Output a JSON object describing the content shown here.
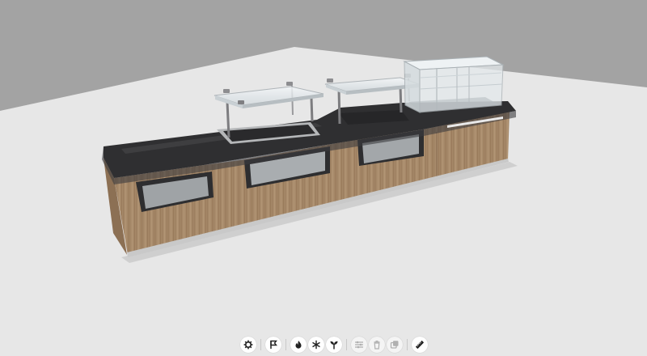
{
  "scene": {
    "model": "food-service-counter",
    "colors": {
      "sky": "#a3a3a3",
      "floor": "#e7e7e7",
      "countertop": "#2f2f31",
      "countertop_edge": "#3b3b3d",
      "wood": "#a78a6a",
      "glass": "#dfe6ea",
      "steel": "#bdbdbd"
    }
  },
  "toolbar": {
    "buttons": [
      {
        "icon": "gear-icon",
        "enabled": true
      },
      {
        "icon": "flag-icon",
        "enabled": true
      },
      {
        "icon": "flame-icon",
        "enabled": true
      },
      {
        "icon": "snowflake-icon",
        "enabled": true
      },
      {
        "icon": "plant-icon",
        "enabled": true
      },
      {
        "icon": "sliders-icon",
        "enabled": false
      },
      {
        "icon": "trash-icon",
        "enabled": false
      },
      {
        "icon": "duplicate-icon",
        "enabled": false
      },
      {
        "icon": "ruler-icon",
        "enabled": true
      }
    ]
  }
}
